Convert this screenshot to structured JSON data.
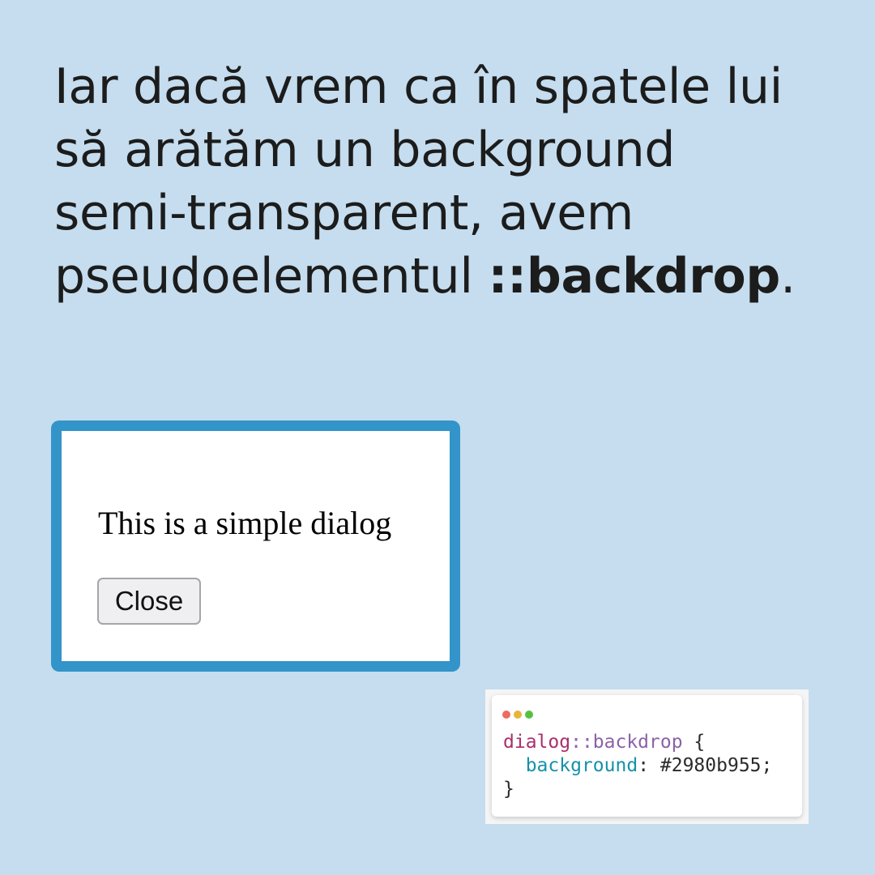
{
  "headline": {
    "line1": "Iar dacă vrem ca în spatele lui",
    "line2": "să arătăm un background",
    "line3": "semi-transparent, avem",
    "line4_prefix": "pseudoelementul ",
    "line4_bold": "::backdrop",
    "line4_suffix": "."
  },
  "dialog": {
    "text": "This is a simple dialog",
    "close_label": "Close",
    "border_color": "#3394c9"
  },
  "code_snippet": {
    "selector": "dialog",
    "pseudo": "::backdrop",
    "open_brace": " {",
    "indent": "  ",
    "property": "background",
    "colon": ": ",
    "value": "#2980b955;",
    "close_brace": "}",
    "window_dots": [
      "red-dot-icon",
      "yellow-dot-icon",
      "green-dot-icon"
    ]
  },
  "colors": {
    "page_background": "#c5ddee",
    "text": "#1c1c1c"
  }
}
